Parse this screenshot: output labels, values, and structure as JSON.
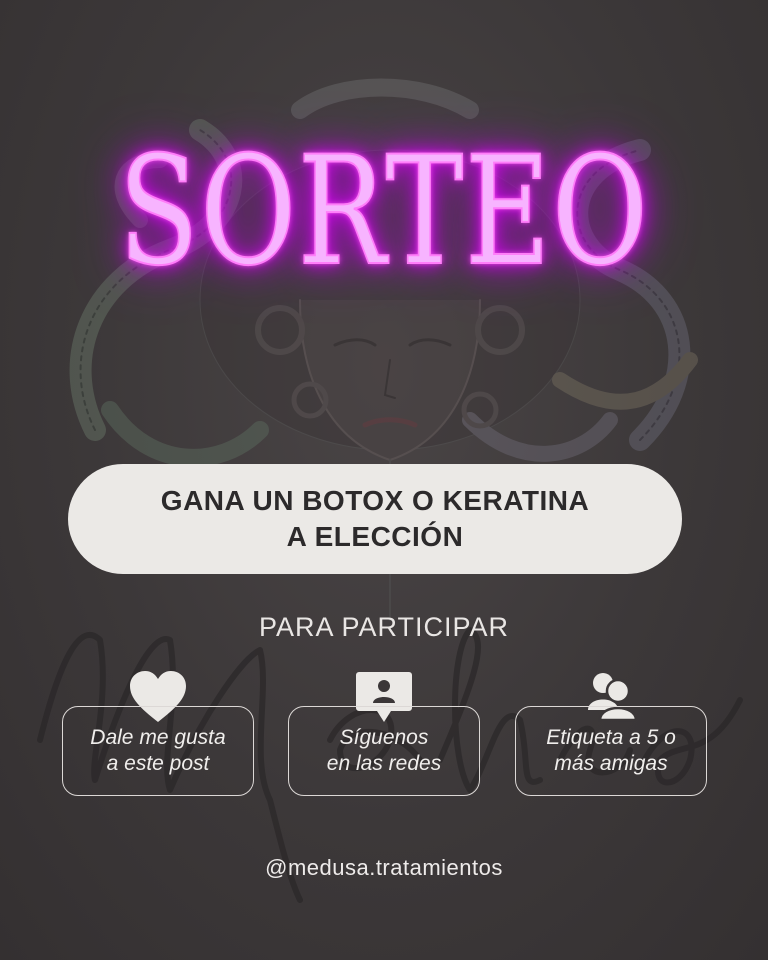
{
  "title": "SORTEO",
  "prize": {
    "line1": "GANA UN BOTOX O KERATINA",
    "line2": "A ELECCIÓN"
  },
  "subtitle": "PARA PARTICIPAR",
  "steps": [
    {
      "icon": "heart-icon",
      "line1": "Dale me gusta",
      "line2": "a este post"
    },
    {
      "icon": "profile-speech-icon",
      "line1": "Síguenos",
      "line2": "en las redes"
    },
    {
      "icon": "people-icon",
      "line1": "Etiqueta a 5 o",
      "line2": "más amigas"
    }
  ],
  "handle": "@medusa.tratamientos",
  "watermark": "Medusa",
  "colors": {
    "background": "#3b3738",
    "neon": "#ff5cf4",
    "pill": "#ebe9e6",
    "text": "#f0eeec"
  }
}
